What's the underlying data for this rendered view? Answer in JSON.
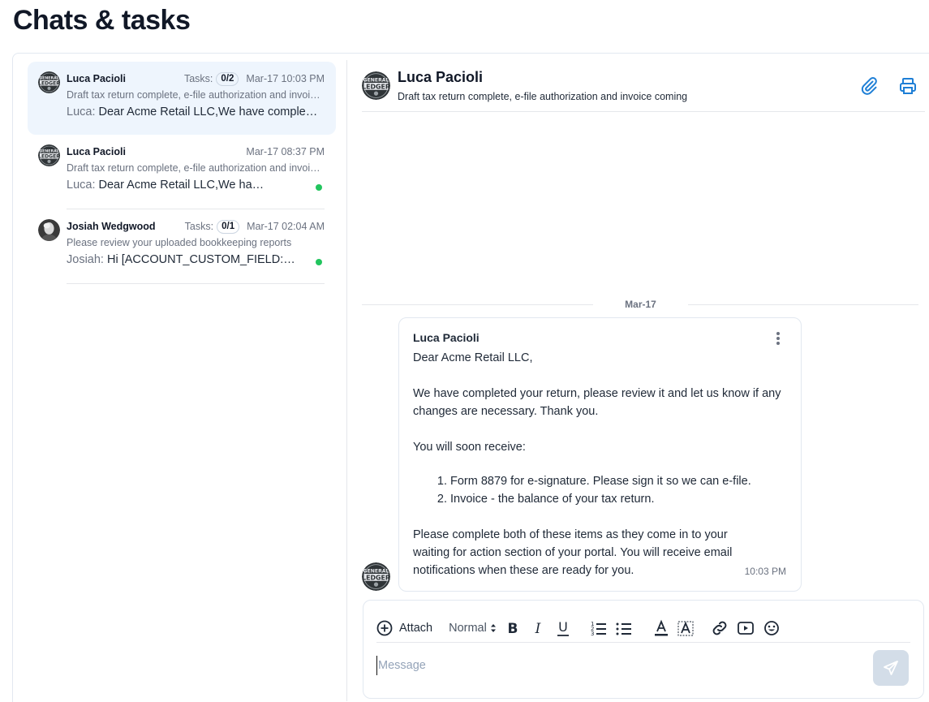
{
  "page": {
    "title": "Chats & tasks"
  },
  "chats": [
    {
      "name": "Luca Pacioli",
      "tasks_label": "Tasks:",
      "tasks_count": "0/2",
      "time": "Mar-17 10:03 PM",
      "subject": "Draft tax return complete, e-file authorization and invoice coming",
      "preview_sender": "Luca:",
      "preview_text": "Dear Acme Retail LLC,We have completed your return",
      "active": true,
      "unread": false
    },
    {
      "name": "Luca Pacioli",
      "time": "Mar-17 08:37 PM",
      "subject": "Draft tax return complete, e-file authorization and invoice coming",
      "preview_sender": "Luca:",
      "preview_text": "Dear Acme Retail LLC,We have completed your return",
      "active": false,
      "unread": true
    },
    {
      "name": "Josiah Wedgwood",
      "tasks_label": "Tasks:",
      "tasks_count": "0/1",
      "time": "Mar-17 02:04 AM",
      "subject": "Please review your uploaded bookkeeping reports",
      "preview_sender": "Josiah:",
      "preview_text": "Hi [ACCOUNT_CUSTOM_FIELD:First Name]",
      "active": false,
      "unread": true
    }
  ],
  "conversation": {
    "title": "Luca Pacioli",
    "subtitle": "Draft tax return complete, e-file authorization and invoice coming",
    "date_separator": "Mar-17",
    "message": {
      "sender": "Luca Pacioli",
      "greeting": "Dear Acme Retail LLC,",
      "para1": "We have completed your return, please review it and let us know if any changes are necessary. Thank you.",
      "para2": "You will soon receive:",
      "list": [
        "Form 8879 for e-signature. Please sign it so we can e-file.",
        "Invoice - the balance of your tax return."
      ],
      "para3": "Please complete both of these items as they come in to your waiting for action section of your portal. You will receive email notifications when these are ready for you.",
      "time": "10:03 PM"
    }
  },
  "composer": {
    "attach_label": "Attach",
    "style_select": "Normal",
    "placeholder": "Message"
  },
  "colors": {
    "accent": "#1e7fd6",
    "active_bg": "#eef5fd",
    "unread_dot": "#22c55e",
    "send_disabled": "#d3dde8"
  },
  "icons": {
    "header": [
      "paperclip-icon",
      "printer-icon"
    ],
    "toolbar": [
      "plus-circle-icon",
      "bold-icon",
      "italic-icon",
      "underline-icon",
      "ordered-list-icon",
      "bullet-list-icon",
      "font-color-icon",
      "highlight-icon",
      "link-icon",
      "video-icon",
      "emoji-icon"
    ],
    "send": "send-icon"
  }
}
